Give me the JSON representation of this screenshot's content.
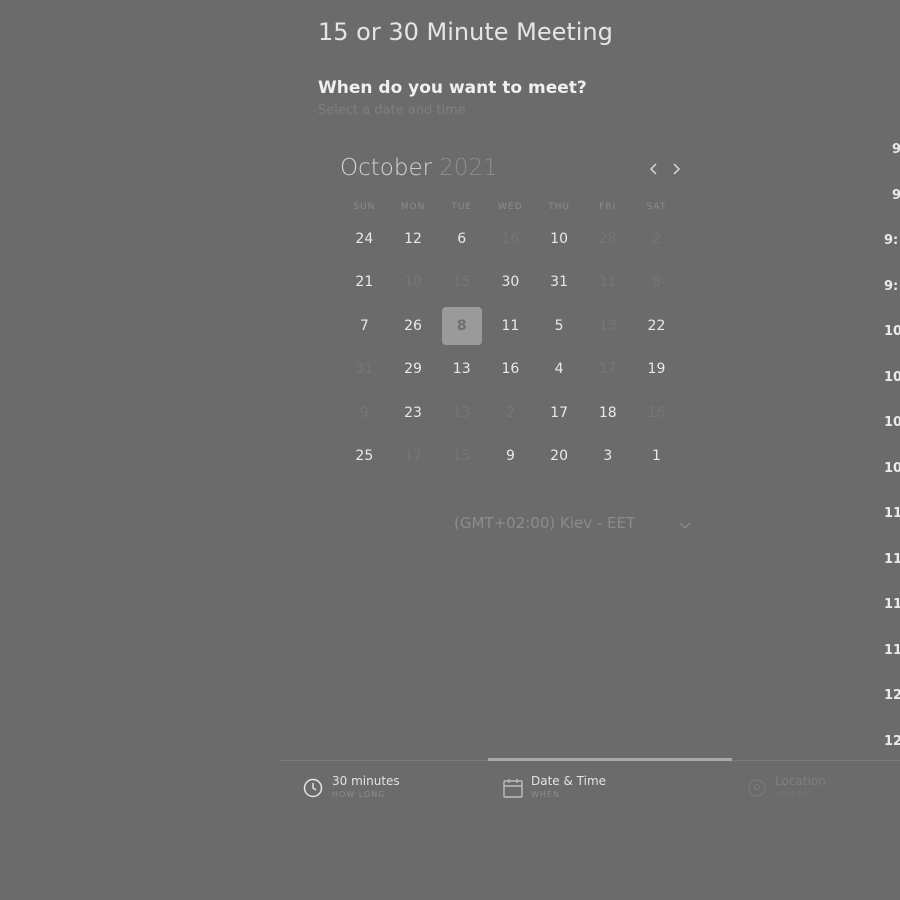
{
  "header": {
    "title": "15 or 30 Minute Meeting",
    "heading": "When do you want to meet?",
    "subheading": "Select a date and time"
  },
  "calendar": {
    "month": "October",
    "year": "2021",
    "weekdays": [
      "SUN",
      "MON",
      "TUE",
      "WED",
      "THU",
      "FRI",
      "SAT"
    ],
    "weeks": [
      [
        {
          "d": "24"
        },
        {
          "d": "12"
        },
        {
          "d": "6"
        },
        {
          "d": "16",
          "muted": true
        },
        {
          "d": "10"
        },
        {
          "d": "28",
          "muted": true
        },
        {
          "d": "2",
          "muted": true
        }
      ],
      [
        {
          "d": "21"
        },
        {
          "d": "10",
          "muted": true
        },
        {
          "d": "15",
          "muted": true
        },
        {
          "d": "30"
        },
        {
          "d": "31"
        },
        {
          "d": "11",
          "muted": true
        },
        {
          "d": "8",
          "muted": true
        }
      ],
      [
        {
          "d": "7"
        },
        {
          "d": "26"
        },
        {
          "d": "8",
          "selected": true
        },
        {
          "d": "11"
        },
        {
          "d": "5"
        },
        {
          "d": "13",
          "muted": true
        },
        {
          "d": "22"
        }
      ],
      [
        {
          "d": "31",
          "muted": true
        },
        {
          "d": "29"
        },
        {
          "d": "13"
        },
        {
          "d": "16"
        },
        {
          "d": "4"
        },
        {
          "d": "17",
          "muted": true
        },
        {
          "d": "19"
        }
      ],
      [
        {
          "d": "9",
          "muted": true
        },
        {
          "d": "23"
        },
        {
          "d": "13",
          "muted": true
        },
        {
          "d": "2",
          "muted": true
        },
        {
          "d": "17"
        },
        {
          "d": "18"
        },
        {
          "d": "16",
          "muted": true
        }
      ],
      [
        {
          "d": "25"
        },
        {
          "d": "17",
          "muted": true
        },
        {
          "d": "15",
          "muted": true
        },
        {
          "d": "9"
        },
        {
          "d": "20"
        },
        {
          "d": "3"
        },
        {
          "d": "1"
        }
      ]
    ]
  },
  "timezone": {
    "label": "(GMT+02:00) Kiev - EET"
  },
  "times": [
    "9",
    "9",
    "9:",
    "9:",
    "10",
    "10",
    "10",
    "10",
    "11",
    "11",
    "11",
    "11",
    "12",
    "12"
  ],
  "steps": [
    {
      "label": "30 minutes",
      "sub": "HOW LONG"
    },
    {
      "label": "Date & Time",
      "sub": "WHEN"
    },
    {
      "label": "Location",
      "sub": "WHERE"
    }
  ],
  "colors": {
    "background": "#6b6b6b",
    "selected_day": "#9a9a9a",
    "active_step_bar": "#a9a9a9"
  }
}
